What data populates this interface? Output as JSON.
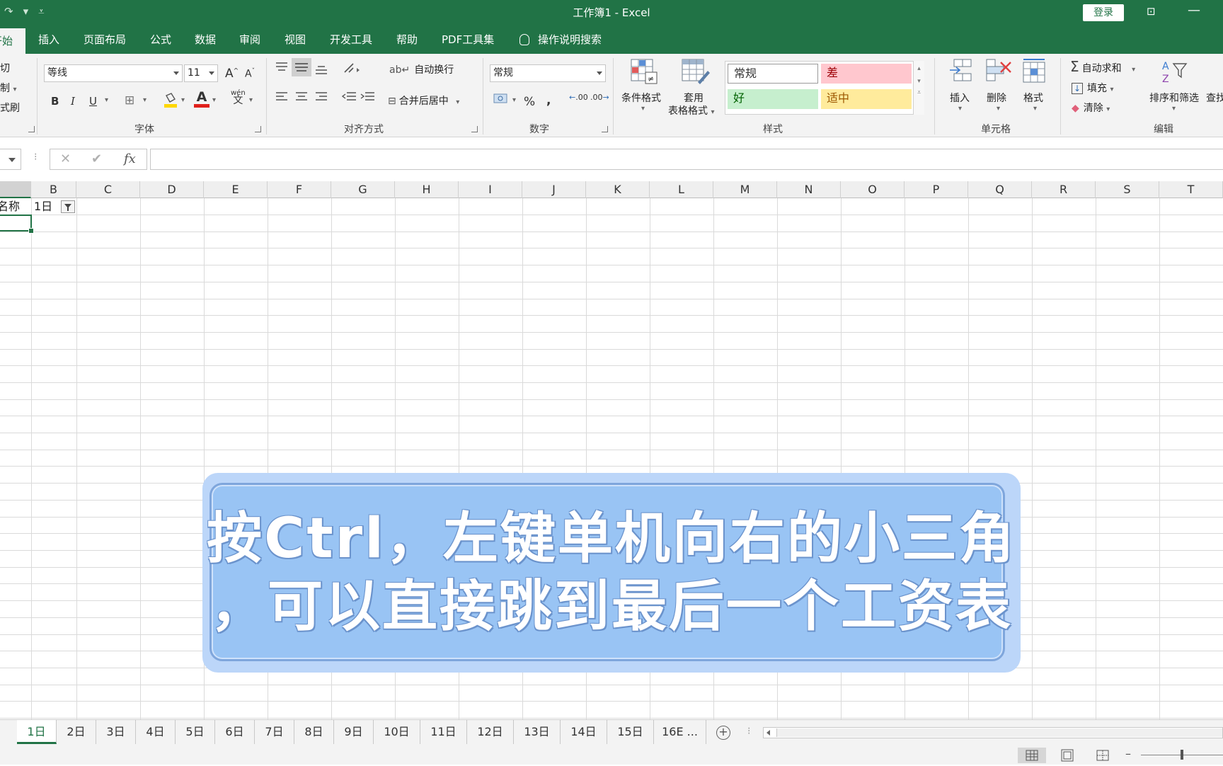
{
  "window": {
    "title": "工作簿1 - Excel",
    "login_label": "登录",
    "quick_access": [
      "↷",
      "▾",
      "⩡"
    ]
  },
  "menu": {
    "tabs": [
      {
        "label": "开始",
        "active": true
      },
      {
        "label": "插入"
      },
      {
        "label": "页面布局"
      },
      {
        "label": "公式"
      },
      {
        "label": "数据"
      },
      {
        "label": "审阅"
      },
      {
        "label": "视图"
      },
      {
        "label": "开发工具"
      },
      {
        "label": "帮助"
      },
      {
        "label": "PDF工具集"
      },
      {
        "label": "操作说明搜索"
      }
    ]
  },
  "ribbon": {
    "clipboard": {
      "cut": "剪切",
      "copy": "复制",
      "format_painter": "格式刷"
    },
    "font": {
      "group": "字体",
      "family": "等线",
      "size": "11",
      "grow": "A",
      "shrink": "A",
      "bold": "B",
      "italic": "I",
      "underline": "U",
      "phonetic": "wén",
      "phonetic_char": "文",
      "font_color_letter": "A",
      "font_color": "#e0201b",
      "fill_color": "#ffd700"
    },
    "alignment": {
      "group": "对齐方式",
      "wrap": "自动换行",
      "merge": "合并后居中"
    },
    "number": {
      "group": "数字",
      "format": "常规",
      "percent": "%",
      "comma": ",",
      "inc_decimal": ".00",
      "dec_decimal": ".00"
    },
    "styles": {
      "group": "样式",
      "conditional": "条件格式",
      "table_l1": "套用",
      "table_l2": "表格格式",
      "cells": [
        {
          "label": "常规",
          "bg": "#ffffff",
          "fg": "#333333"
        },
        {
          "label": "差",
          "bg": "#ffc7ce",
          "fg": "#9c0006"
        },
        {
          "label": "好",
          "bg": "#c6efce",
          "fg": "#006100"
        },
        {
          "label": "适中",
          "bg": "#ffeb9c",
          "fg": "#9c5700"
        }
      ]
    },
    "cells": {
      "group": "单元格",
      "insert": "插入",
      "delete": "删除",
      "format": "格式"
    },
    "editing": {
      "group": "编辑",
      "autosum": "自动求和",
      "fill": "填充",
      "clear": "清除",
      "sort": "排序和筛选",
      "find": "查找"
    }
  },
  "formula_bar": {
    "cancel": "✕",
    "enter": "✔",
    "fx": "fx",
    "value": ""
  },
  "grid": {
    "columns": [
      "B",
      "C",
      "D",
      "E",
      "F",
      "G",
      "H",
      "I",
      "J",
      "K",
      "L",
      "M",
      "N",
      "O",
      "P",
      "Q",
      "R",
      "S",
      "T"
    ],
    "a1": "名称",
    "b1": "1日",
    "selected_cell": "A2"
  },
  "caption": {
    "line1": "按Ctrl，左键单机向右的小三角",
    "line2": "，可以直接跳到最后一个工资表"
  },
  "sheets": [
    "1日",
    "2日",
    "3日",
    "4日",
    "5日",
    "6日",
    "7日",
    "8日",
    "9日",
    "10日",
    "11日",
    "12日",
    "13日",
    "14日",
    "15日",
    "16E ..."
  ],
  "active_sheet": "1日"
}
